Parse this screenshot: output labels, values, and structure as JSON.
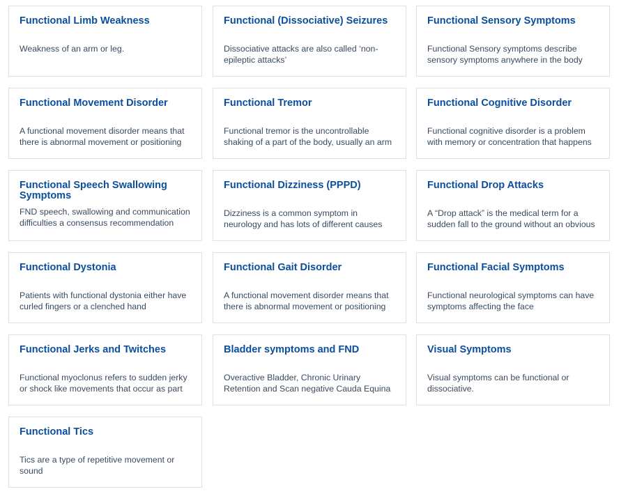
{
  "cards": [
    {
      "title": "Functional Limb Weakness",
      "desc": "Weakness of an arm or leg."
    },
    {
      "title": "Functional (Dissociative) Seizures",
      "desc": "Dissociative attacks are also called ‘non-epileptic attacks’"
    },
    {
      "title": "Functional Sensory Symptoms",
      "desc": "Functional Sensory symptoms describe sensory symptoms anywhere in the body that"
    },
    {
      "title": "Functional Movement Disorder",
      "desc": "A functional movement disorder means that there is abnormal movement or positioning of"
    },
    {
      "title": "Functional Tremor",
      "desc": "Functional tremor is the uncontrollable shaking of a part of the body, usually an arm"
    },
    {
      "title": "Functional Cognitive Disorder",
      "desc": "Functional cognitive disorder is a problem with memory or concentration that happens"
    },
    {
      "title": "Functional Speech Swallowing Symptoms",
      "desc": "FND speech, swallowing and communication difficulties a consensus recommendation"
    },
    {
      "title": "Functional Dizziness (PPPD)",
      "desc": "Dizziness is a common symptom in neurology and has lots of different causes"
    },
    {
      "title": "Functional Drop Attacks",
      "desc": "A “Drop attack” is the medical term for a sudden fall to the ground without an obvious"
    },
    {
      "title": "Functional Dystonia",
      "desc": "Patients with functional dystonia either have curled fingers or a clenched hand"
    },
    {
      "title": "Functional Gait Disorder",
      "desc": "A functional movement disorder means that there is abnormal movement or positioning of"
    },
    {
      "title": "Functional Facial Symptoms",
      "desc": "Functional neurological symptoms can have symptoms affecting the face"
    },
    {
      "title": "Functional Jerks and Twitches",
      "desc": "Functional myoclonus refers to sudden jerky or shock like movements that occur as part of"
    },
    {
      "title": "Bladder symptoms and FND",
      "desc": "Overactive Bladder, Chronic Urinary Retention and Scan negative Cauda Equina"
    },
    {
      "title": "Visual Symptoms",
      "desc": "Visual symptoms can be functional or dissociative."
    },
    {
      "title": "Functional Tics",
      "desc": "Tics are a type of repetitive movement or sound"
    }
  ]
}
